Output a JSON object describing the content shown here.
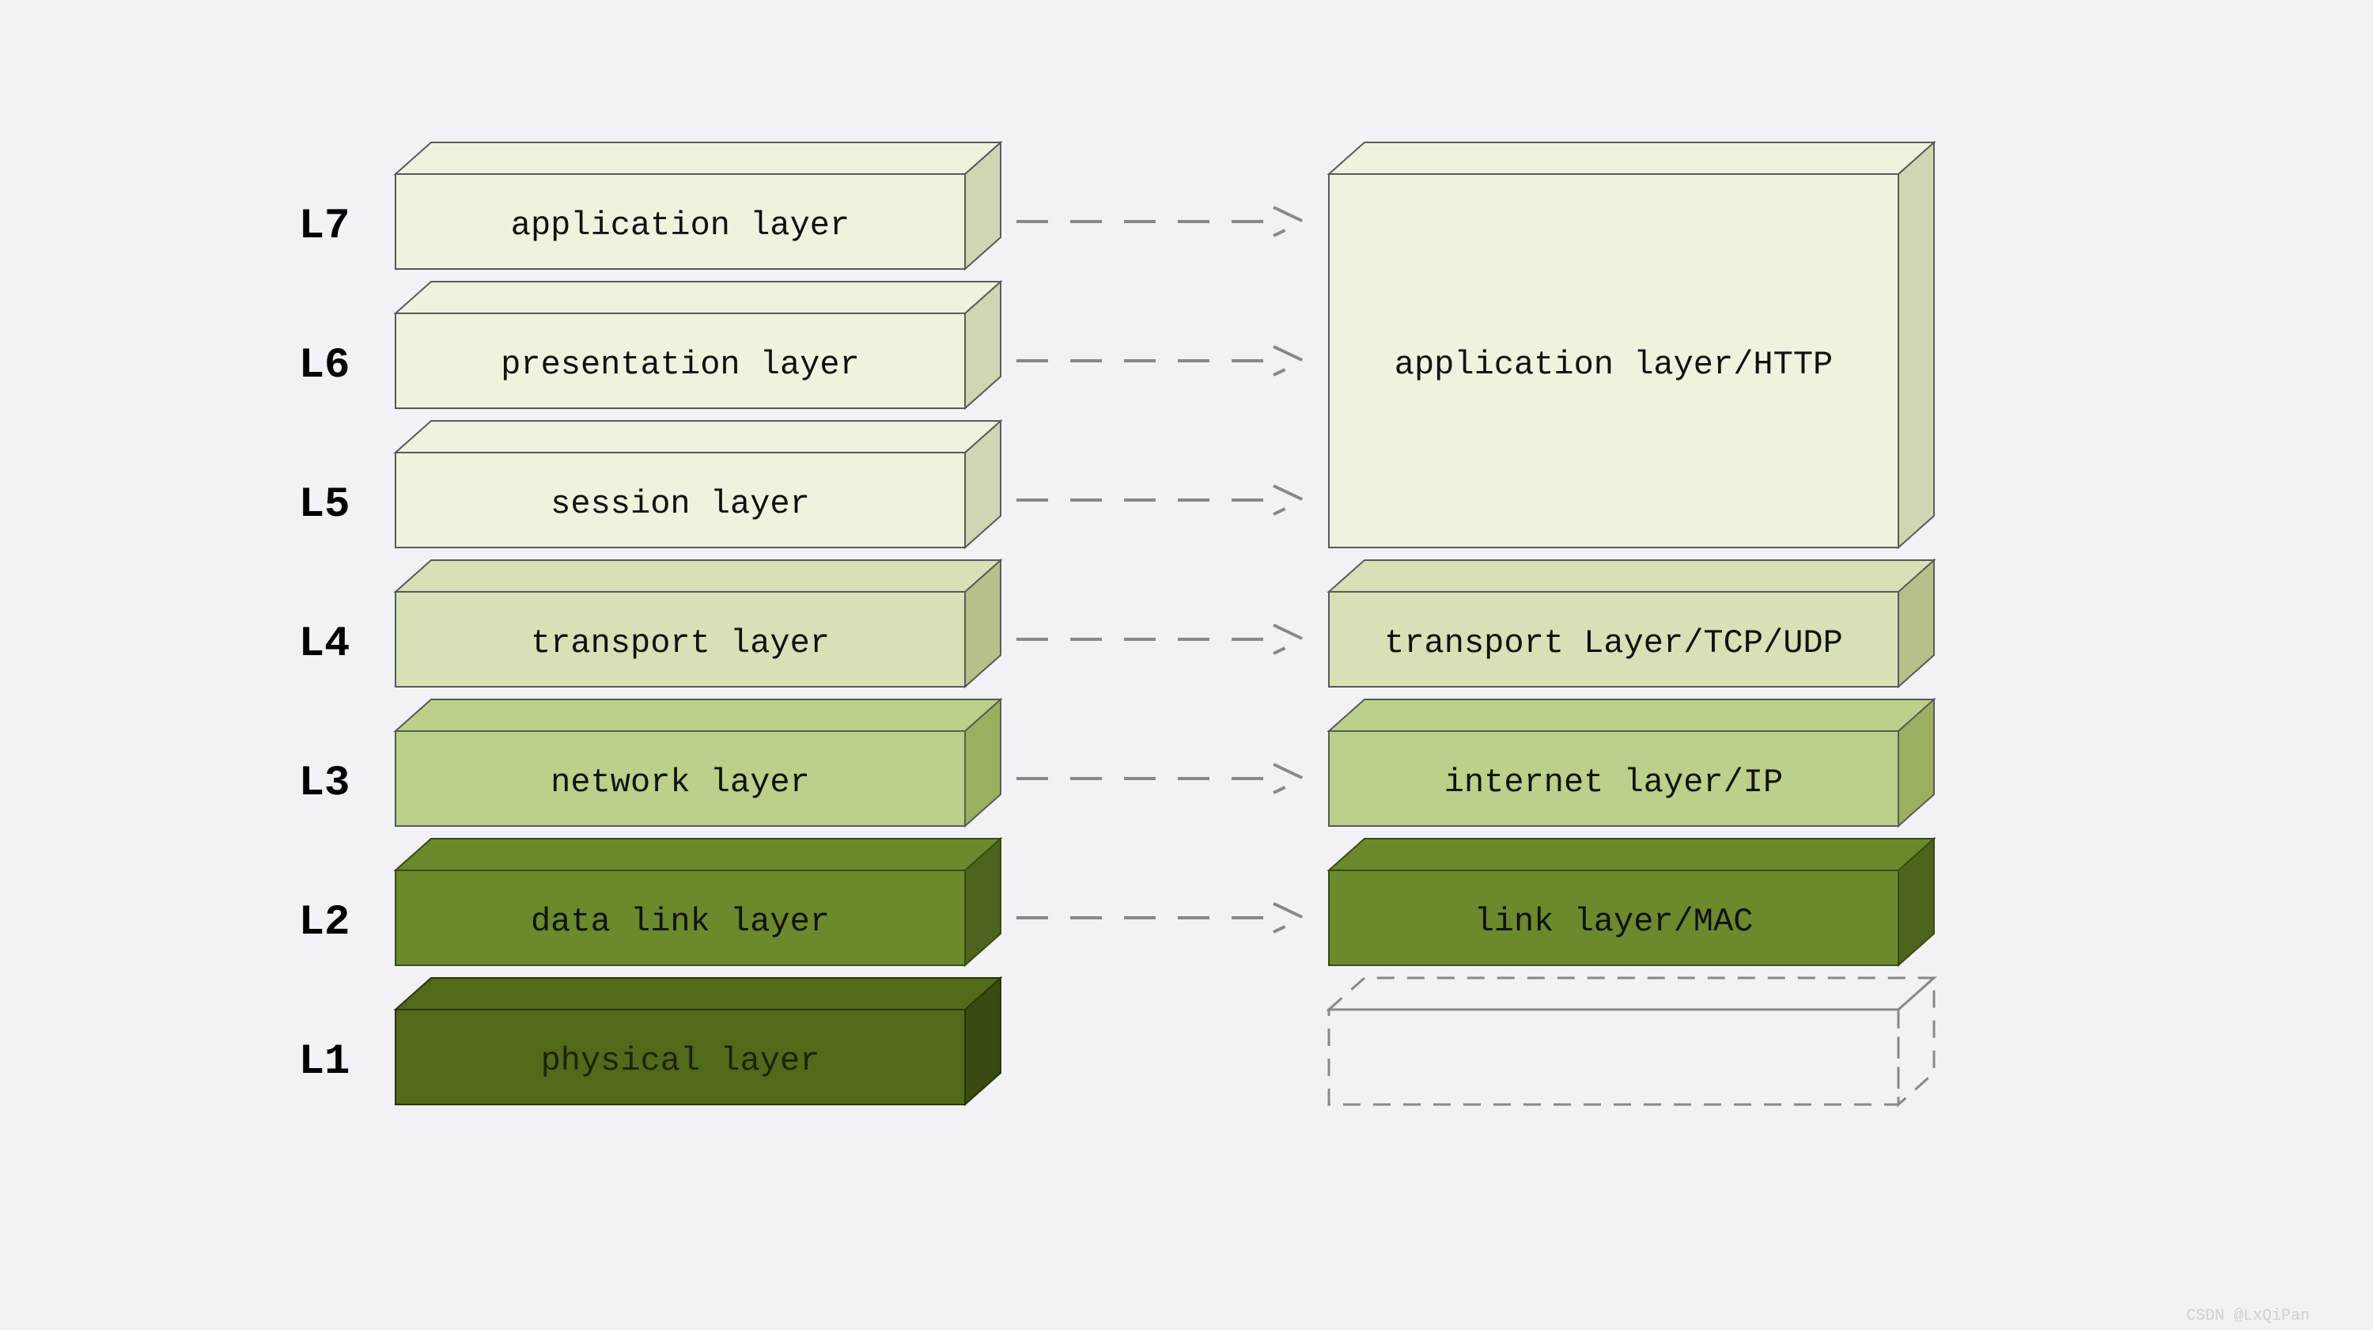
{
  "labels": {
    "L7": "L7",
    "L6": "L6",
    "L5": "L5",
    "L4": "L4",
    "L3": "L3",
    "L2": "L2",
    "L1": "L1"
  },
  "left": {
    "L7": "application layer",
    "L6": "presentation layer",
    "L5": "session layer",
    "L4": "transport layer",
    "L3": "network layer",
    "L2": "data link layer",
    "L1": "physical layer"
  },
  "right": {
    "app": "application layer/HTTP",
    "transport": "transport Layer/TCP/UDP",
    "internet": "internet layer/IP",
    "link": "link layer/MAC",
    "empty": ""
  },
  "colors": {
    "c1": {
      "front": "#eef3de",
      "top": "#eef3de",
      "side": "#cdd7b2",
      "stroke": "#5a5a5a"
    },
    "c2": {
      "front": "#d6e2b6",
      "top": "#d6e2b6",
      "side": "#b4c188",
      "stroke": "#5a5a5a"
    },
    "c3": {
      "front": "#bbd088",
      "top": "#bbd088",
      "side": "#9ab060",
      "stroke": "#5a5a5a"
    },
    "c4": {
      "front": "#6a8a2c",
      "top": "#6a8a2c",
      "side": "#4c641c",
      "stroke": "#3a4a14"
    },
    "c5": {
      "front": "#516a1a",
      "top": "#516a1a",
      "side": "#394b10",
      "stroke": "#2a350b"
    }
  },
  "watermark": "CSDN @LxQiPan",
  "chart_data": {
    "type": "table",
    "title": "OSI 7-layer model vs TCP/IP model",
    "osi_layers": [
      {
        "level": "L7",
        "name": "application layer"
      },
      {
        "level": "L6",
        "name": "presentation layer"
      },
      {
        "level": "L5",
        "name": "session layer"
      },
      {
        "level": "L4",
        "name": "transport layer"
      },
      {
        "level": "L3",
        "name": "network layer"
      },
      {
        "level": "L2",
        "name": "data link layer"
      },
      {
        "level": "L1",
        "name": "physical layer"
      }
    ],
    "tcpip_layers": [
      {
        "name": "application layer/HTTP",
        "maps_to": [
          "L7",
          "L6",
          "L5"
        ]
      },
      {
        "name": "transport Layer/TCP/UDP",
        "maps_to": [
          "L4"
        ]
      },
      {
        "name": "internet layer/IP",
        "maps_to": [
          "L3"
        ]
      },
      {
        "name": "link layer/MAC",
        "maps_to": [
          "L2"
        ]
      },
      {
        "name": "",
        "maps_to": [
          "L1"
        ],
        "empty": true
      }
    ]
  }
}
